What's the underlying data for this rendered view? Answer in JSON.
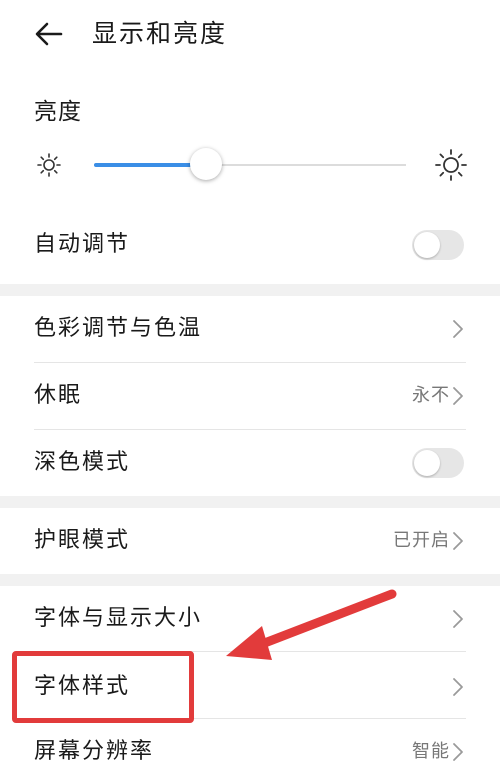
{
  "header": {
    "title": "显示和亮度"
  },
  "brightness": {
    "label": "亮度",
    "level_percent": 36
  },
  "rows": {
    "auto_adjust": {
      "label": "自动调节",
      "toggle_on": false
    },
    "color_temp": {
      "label": "色彩调节与色温"
    },
    "sleep": {
      "label": "休眠",
      "value": "永不"
    },
    "dark_mode": {
      "label": "深色模式",
      "toggle_on": false
    },
    "eye_comfort": {
      "label": "护眼模式",
      "value": "已开启"
    },
    "font_display_size": {
      "label": "字体与显示大小"
    },
    "font_style": {
      "label": "字体样式"
    },
    "resolution": {
      "label": "屏幕分辨率",
      "value": "智能"
    }
  },
  "colors": {
    "accent": "#3a8ee6",
    "annotation": "#e23b3b",
    "section_gap": "#f1f1f1"
  }
}
